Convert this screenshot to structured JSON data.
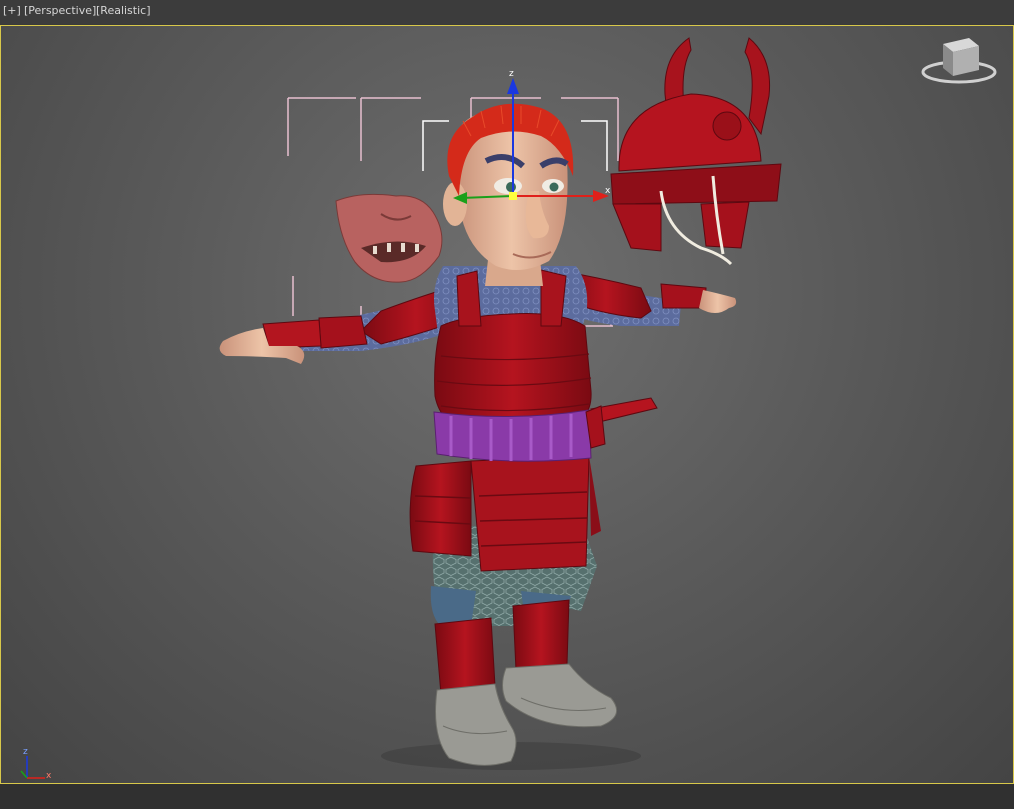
{
  "viewport_menu": {
    "plus_label": "[+]",
    "view_label": "[Perspective]",
    "shading_label": "[Realistic]"
  },
  "gizmo": {
    "x_label": "x",
    "z_label": "z"
  },
  "world_axis": {
    "x_label": "x",
    "z_label": "z"
  },
  "colors": {
    "viewport_border": "#d8c84a",
    "armor_red": "#a5111c",
    "sash_purple": "#8a3aa8",
    "skin": "#e6b99a",
    "hair": "#d42a1a",
    "axis_x": "#e0201a",
    "axis_y": "#1aa01a",
    "axis_z": "#1a38e0"
  },
  "icons": [
    "viewcube-icon",
    "transform-gizmo-icon",
    "world-axis-icon"
  ]
}
